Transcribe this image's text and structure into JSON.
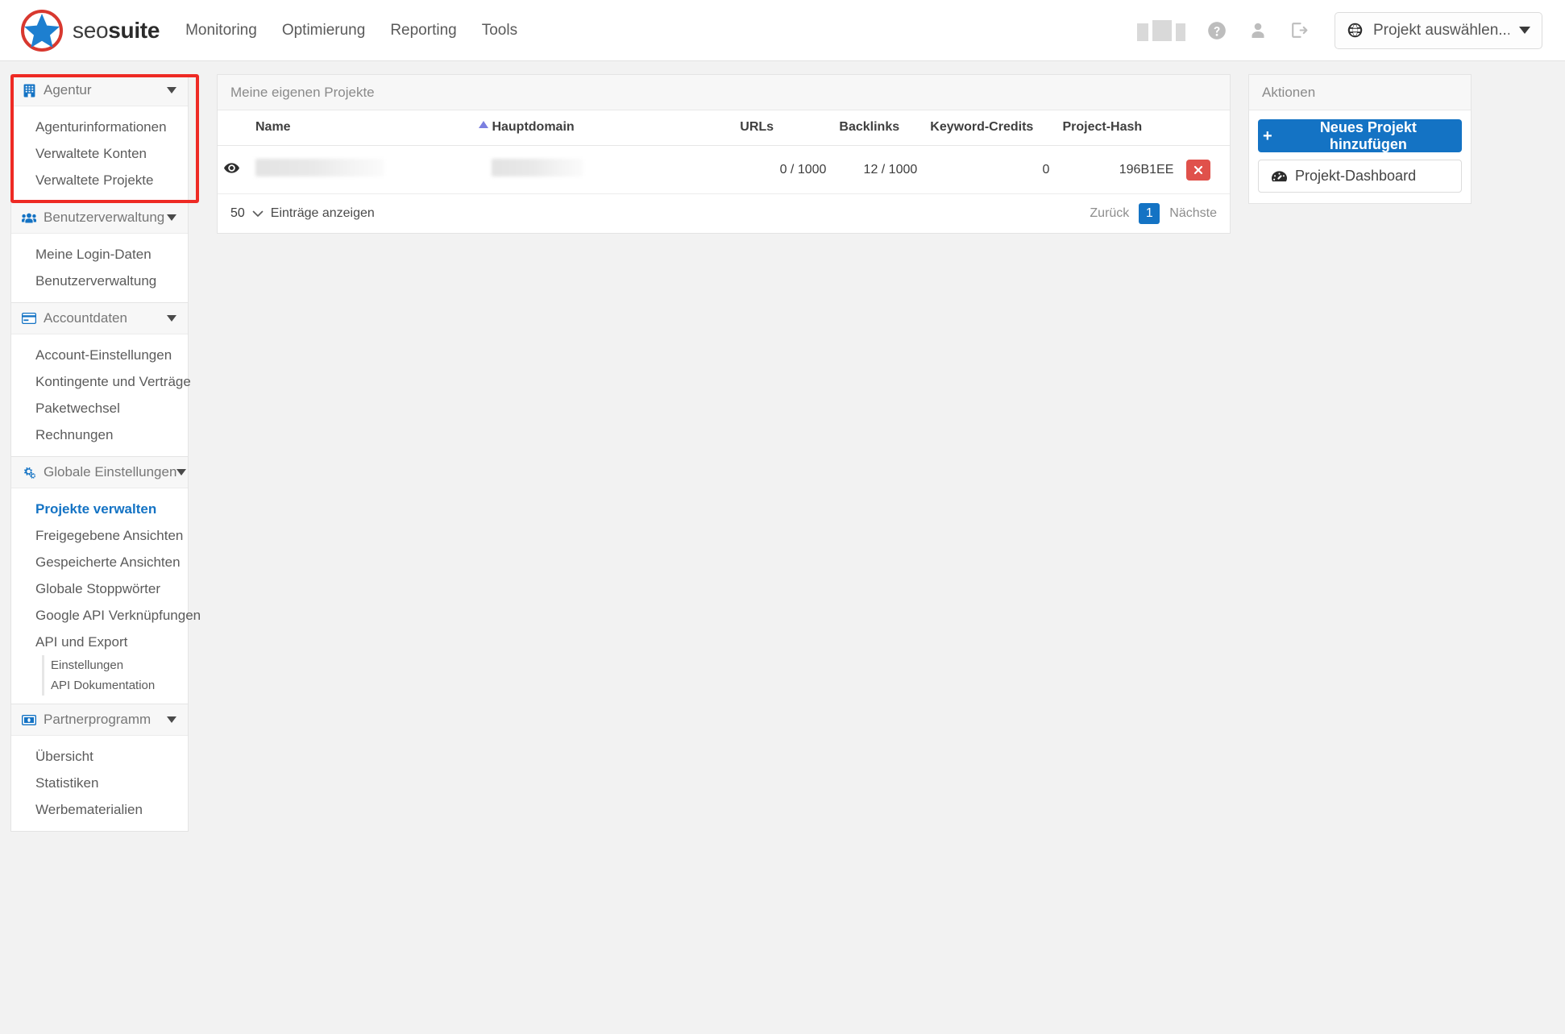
{
  "brand": {
    "name_light": "seo",
    "name_bold": "suite",
    "logo_icon": "star-logo-icon"
  },
  "topnav": {
    "items": [
      {
        "label": "Monitoring"
      },
      {
        "label": "Optimierung"
      },
      {
        "label": "Reporting"
      },
      {
        "label": "Tools"
      }
    ]
  },
  "topright": {
    "bars_icon": "chart-bars-icon",
    "help_icon": "question-circle-icon",
    "user_icon": "user-icon",
    "logout_icon": "logout-icon",
    "project_select": {
      "globe_icon": "globe-icon",
      "value": "Projekt auswählen...",
      "caret_icon": "caret-down-icon"
    }
  },
  "sidebar": {
    "sections": [
      {
        "id": "agentur",
        "label": "Agentur",
        "icon": "building-icon",
        "highlighted": true,
        "items": [
          {
            "label": "Agenturinformationen",
            "active": false
          },
          {
            "label": "Verwaltete Konten",
            "active": false
          },
          {
            "label": "Verwaltete Projekte",
            "active": false
          }
        ]
      },
      {
        "id": "benutzerverwaltung",
        "label": "Benutzerverwaltung",
        "icon": "users-icon",
        "highlighted": false,
        "items": [
          {
            "label": "Meine Login-Daten",
            "active": false
          },
          {
            "label": "Benutzerverwaltung",
            "active": false
          }
        ]
      },
      {
        "id": "accountdaten",
        "label": "Accountdaten",
        "icon": "credit-card-icon",
        "highlighted": false,
        "items": [
          {
            "label": "Account-Einstellungen",
            "active": false
          },
          {
            "label": "Kontingente und Verträge",
            "active": false
          },
          {
            "label": "Paketwechsel",
            "active": false
          },
          {
            "label": "Rechnungen",
            "active": false
          }
        ]
      },
      {
        "id": "globale-einstellungen",
        "label": "Globale Einstellungen",
        "icon": "gears-icon",
        "highlighted": false,
        "items": [
          {
            "label": "Projekte verwalten",
            "active": true
          },
          {
            "label": "Freigegebene Ansichten",
            "active": false
          },
          {
            "label": "Gespeicherte Ansichten",
            "active": false
          },
          {
            "label": "Globale Stoppwörter",
            "active": false
          },
          {
            "label": "Google API Verknüpfungen",
            "active": false
          },
          {
            "label": "API und Export",
            "active": false
          }
        ],
        "subitems": [
          {
            "label": "Einstellungen"
          },
          {
            "label": "API Dokumentation"
          }
        ]
      },
      {
        "id": "partnerprogramm",
        "label": "Partnerprogramm",
        "icon": "money-bill-icon",
        "highlighted": false,
        "items": [
          {
            "label": "Übersicht",
            "active": false
          },
          {
            "label": "Statistiken",
            "active": false
          },
          {
            "label": "Werbematerialien",
            "active": false
          }
        ]
      }
    ]
  },
  "main": {
    "panel_title": "Meine eigenen Projekte",
    "table": {
      "columns": [
        {
          "key": "eye",
          "label": ""
        },
        {
          "key": "name",
          "label": "Name"
        },
        {
          "key": "domain",
          "label": "Hauptdomain",
          "sorted": "asc"
        },
        {
          "key": "urls",
          "label": "URLs"
        },
        {
          "key": "backlinks",
          "label": "Backlinks"
        },
        {
          "key": "credits",
          "label": "Keyword-Credits"
        },
        {
          "key": "hash",
          "label": "Project-Hash"
        },
        {
          "key": "actions",
          "label": ""
        }
      ],
      "rows": [
        {
          "eye_icon": "eye-icon",
          "name": "",
          "domain": "",
          "urls": "0 / 1000",
          "backlinks": "12 / 1000",
          "credits": "0",
          "hash": "196B1EE",
          "delete_icon": "close-x-icon"
        }
      ]
    },
    "footer": {
      "per_page": "50",
      "per_page_caret": "chevron-down-icon",
      "per_page_label": "Einträge anzeigen",
      "prev": "Zurück",
      "current_page": "1",
      "next": "Nächste"
    }
  },
  "right_panel": {
    "title": "Aktionen",
    "add_project_label": "Neues Projekt hinzufügen",
    "add_project_icon": "plus-icon",
    "dashboard_label": "Projekt-Dashboard",
    "dashboard_icon": "dashboard-icon"
  },
  "colors": {
    "accent": "#1473c4",
    "danger": "#e0514b",
    "highlight_box": "#ee2a24",
    "sort_arrow": "#7b7fe0"
  }
}
